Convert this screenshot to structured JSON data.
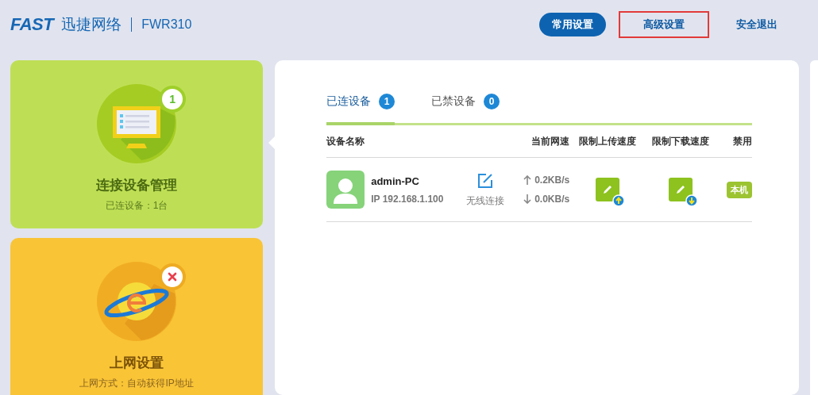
{
  "header": {
    "logo": "FAST",
    "brand": "迅捷网络",
    "model": "FWR310",
    "nav": [
      {
        "label": "常用设置",
        "selected": true,
        "outlined": false
      },
      {
        "label": "高级设置",
        "selected": false,
        "outlined": true
      },
      {
        "label": "安全退出",
        "selected": false,
        "outlined": false
      }
    ]
  },
  "cards": [
    {
      "kind": "devices",
      "title": "连接设备管理",
      "subtitle": "已连设备：1台",
      "badge": {
        "kind": "count",
        "text": "1"
      }
    },
    {
      "kind": "internet",
      "title": "上网设置",
      "subtitle": "上网方式：自动获得IP地址",
      "badge": {
        "kind": "error"
      }
    }
  ],
  "tabs": [
    {
      "label": "已连设备",
      "count": "1",
      "selected": true
    },
    {
      "label": "已禁设备",
      "count": "0",
      "selected": false
    }
  ],
  "table": {
    "columns": [
      "设备名称",
      "当前网速",
      "限制上传速度",
      "限制下载速度",
      "禁用"
    ],
    "rows": [
      {
        "name": "admin-PC",
        "ip": "IP 192.168.1.100",
        "connection": "无线连接",
        "upload": "0.2KB/s",
        "download": "0.0KB/s",
        "tag": "本机"
      }
    ]
  }
}
